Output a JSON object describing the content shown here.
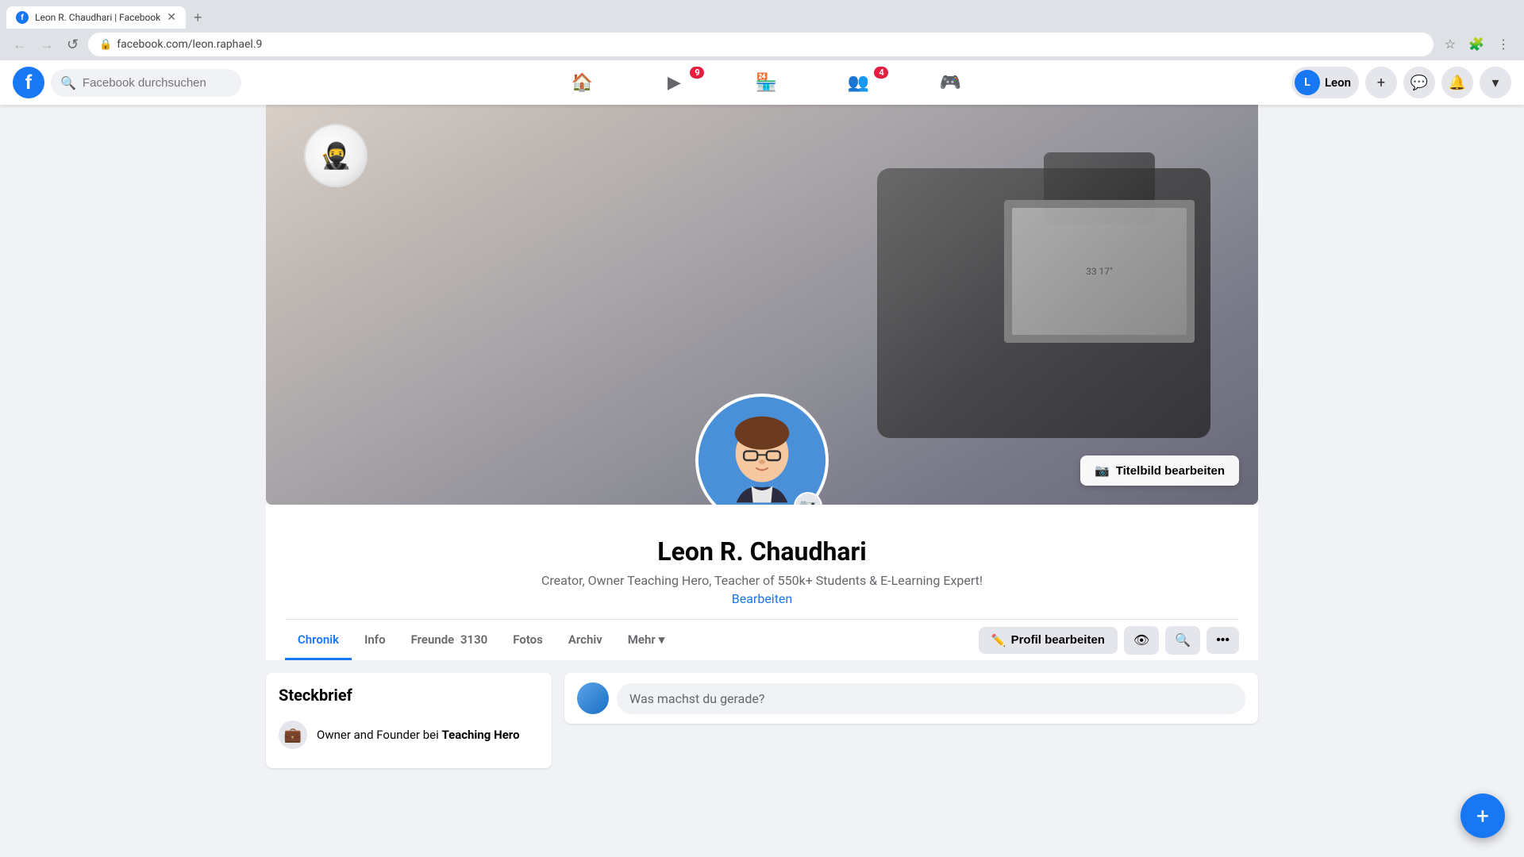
{
  "browser": {
    "tab_title": "Leon R. Chaudhari | Facebook",
    "url": "facebook.com/leon.raphael.9",
    "new_tab_label": "+"
  },
  "navbar": {
    "logo_letter": "f",
    "search_placeholder": "Facebook durchsuchen",
    "nav_items": [
      {
        "id": "home",
        "icon": "🏠",
        "badge": null
      },
      {
        "id": "video",
        "icon": "▶",
        "badge": "9"
      },
      {
        "id": "shop",
        "icon": "🏪",
        "badge": null
      },
      {
        "id": "groups",
        "icon": "👥",
        "badge": "4"
      },
      {
        "id": "gaming",
        "icon": "🎮",
        "badge": null
      }
    ],
    "user_name": "Leon",
    "create_label": "+",
    "messenger_icon": "💬",
    "notifications_icon": "🔔",
    "menu_icon": "▾"
  },
  "profile": {
    "cover_edit_label": "Titelbild bearbeiten",
    "name": "Leon R. Chaudhari",
    "bio": "Creator, Owner Teaching Hero, Teacher of 550k+ Students & E-Learning Expert!",
    "edit_bio_label": "Bearbeiten",
    "tabs": [
      {
        "id": "chronik",
        "label": "Chronik",
        "active": true
      },
      {
        "id": "info",
        "label": "Info"
      },
      {
        "id": "freunde",
        "label": "Freunde",
        "count": "3130"
      },
      {
        "id": "fotos",
        "label": "Fotos"
      },
      {
        "id": "archiv",
        "label": "Archiv"
      },
      {
        "id": "mehr",
        "label": "Mehr"
      }
    ],
    "actions": {
      "edit_profile": "Profil bearbeiten",
      "view_icon": "👁",
      "search_icon": "🔍",
      "more_icon": "•••"
    }
  },
  "steckbrief": {
    "title": "Steckbrief",
    "work": "Owner and Founder bei Teaching Hero"
  },
  "post_box": {
    "placeholder": "Was machst du gerade?"
  },
  "fab_icon": "+"
}
